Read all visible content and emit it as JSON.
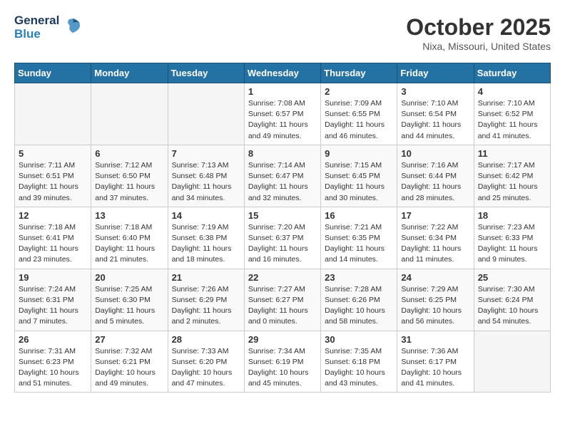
{
  "logo": {
    "line1": "General",
    "line2": "Blue"
  },
  "title": "October 2025",
  "subtitle": "Nixa, Missouri, United States",
  "weekdays": [
    "Sunday",
    "Monday",
    "Tuesday",
    "Wednesday",
    "Thursday",
    "Friday",
    "Saturday"
  ],
  "weeks": [
    [
      {
        "day": "",
        "info": ""
      },
      {
        "day": "",
        "info": ""
      },
      {
        "day": "",
        "info": ""
      },
      {
        "day": "1",
        "info": "Sunrise: 7:08 AM\nSunset: 6:57 PM\nDaylight: 11 hours\nand 49 minutes."
      },
      {
        "day": "2",
        "info": "Sunrise: 7:09 AM\nSunset: 6:55 PM\nDaylight: 11 hours\nand 46 minutes."
      },
      {
        "day": "3",
        "info": "Sunrise: 7:10 AM\nSunset: 6:54 PM\nDaylight: 11 hours\nand 44 minutes."
      },
      {
        "day": "4",
        "info": "Sunrise: 7:10 AM\nSunset: 6:52 PM\nDaylight: 11 hours\nand 41 minutes."
      }
    ],
    [
      {
        "day": "5",
        "info": "Sunrise: 7:11 AM\nSunset: 6:51 PM\nDaylight: 11 hours\nand 39 minutes."
      },
      {
        "day": "6",
        "info": "Sunrise: 7:12 AM\nSunset: 6:50 PM\nDaylight: 11 hours\nand 37 minutes."
      },
      {
        "day": "7",
        "info": "Sunrise: 7:13 AM\nSunset: 6:48 PM\nDaylight: 11 hours\nand 34 minutes."
      },
      {
        "day": "8",
        "info": "Sunrise: 7:14 AM\nSunset: 6:47 PM\nDaylight: 11 hours\nand 32 minutes."
      },
      {
        "day": "9",
        "info": "Sunrise: 7:15 AM\nSunset: 6:45 PM\nDaylight: 11 hours\nand 30 minutes."
      },
      {
        "day": "10",
        "info": "Sunrise: 7:16 AM\nSunset: 6:44 PM\nDaylight: 11 hours\nand 28 minutes."
      },
      {
        "day": "11",
        "info": "Sunrise: 7:17 AM\nSunset: 6:42 PM\nDaylight: 11 hours\nand 25 minutes."
      }
    ],
    [
      {
        "day": "12",
        "info": "Sunrise: 7:18 AM\nSunset: 6:41 PM\nDaylight: 11 hours\nand 23 minutes."
      },
      {
        "day": "13",
        "info": "Sunrise: 7:18 AM\nSunset: 6:40 PM\nDaylight: 11 hours\nand 21 minutes."
      },
      {
        "day": "14",
        "info": "Sunrise: 7:19 AM\nSunset: 6:38 PM\nDaylight: 11 hours\nand 18 minutes."
      },
      {
        "day": "15",
        "info": "Sunrise: 7:20 AM\nSunset: 6:37 PM\nDaylight: 11 hours\nand 16 minutes."
      },
      {
        "day": "16",
        "info": "Sunrise: 7:21 AM\nSunset: 6:35 PM\nDaylight: 11 hours\nand 14 minutes."
      },
      {
        "day": "17",
        "info": "Sunrise: 7:22 AM\nSunset: 6:34 PM\nDaylight: 11 hours\nand 11 minutes."
      },
      {
        "day": "18",
        "info": "Sunrise: 7:23 AM\nSunset: 6:33 PM\nDaylight: 11 hours\nand 9 minutes."
      }
    ],
    [
      {
        "day": "19",
        "info": "Sunrise: 7:24 AM\nSunset: 6:31 PM\nDaylight: 11 hours\nand 7 minutes."
      },
      {
        "day": "20",
        "info": "Sunrise: 7:25 AM\nSunset: 6:30 PM\nDaylight: 11 hours\nand 5 minutes."
      },
      {
        "day": "21",
        "info": "Sunrise: 7:26 AM\nSunset: 6:29 PM\nDaylight: 11 hours\nand 2 minutes."
      },
      {
        "day": "22",
        "info": "Sunrise: 7:27 AM\nSunset: 6:27 PM\nDaylight: 11 hours\nand 0 minutes."
      },
      {
        "day": "23",
        "info": "Sunrise: 7:28 AM\nSunset: 6:26 PM\nDaylight: 10 hours\nand 58 minutes."
      },
      {
        "day": "24",
        "info": "Sunrise: 7:29 AM\nSunset: 6:25 PM\nDaylight: 10 hours\nand 56 minutes."
      },
      {
        "day": "25",
        "info": "Sunrise: 7:30 AM\nSunset: 6:24 PM\nDaylight: 10 hours\nand 54 minutes."
      }
    ],
    [
      {
        "day": "26",
        "info": "Sunrise: 7:31 AM\nSunset: 6:23 PM\nDaylight: 10 hours\nand 51 minutes."
      },
      {
        "day": "27",
        "info": "Sunrise: 7:32 AM\nSunset: 6:21 PM\nDaylight: 10 hours\nand 49 minutes."
      },
      {
        "day": "28",
        "info": "Sunrise: 7:33 AM\nSunset: 6:20 PM\nDaylight: 10 hours\nand 47 minutes."
      },
      {
        "day": "29",
        "info": "Sunrise: 7:34 AM\nSunset: 6:19 PM\nDaylight: 10 hours\nand 45 minutes."
      },
      {
        "day": "30",
        "info": "Sunrise: 7:35 AM\nSunset: 6:18 PM\nDaylight: 10 hours\nand 43 minutes."
      },
      {
        "day": "31",
        "info": "Sunrise: 7:36 AM\nSunset: 6:17 PM\nDaylight: 10 hours\nand 41 minutes."
      },
      {
        "day": "",
        "info": ""
      }
    ]
  ]
}
